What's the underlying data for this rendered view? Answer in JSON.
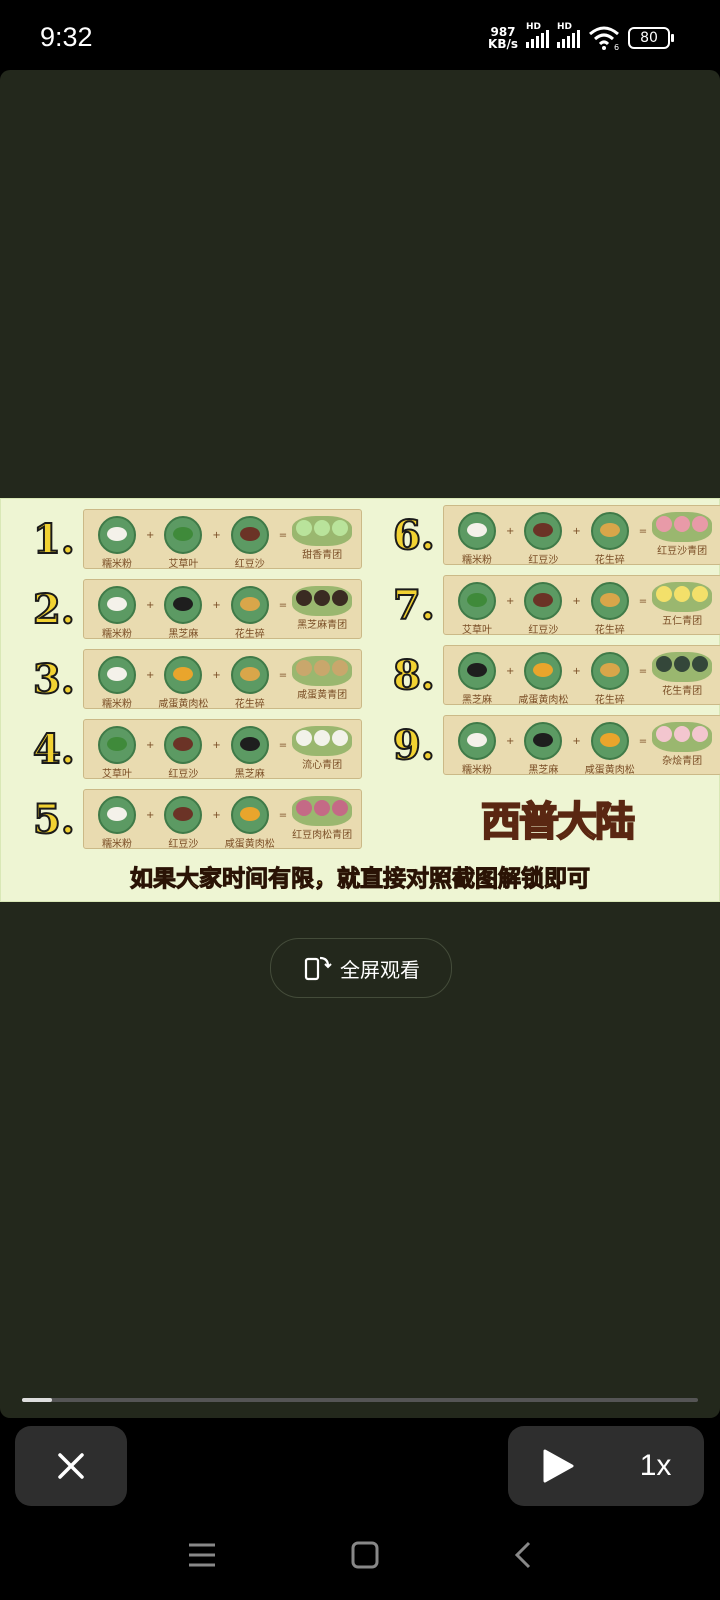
{
  "status": {
    "time": "9:32",
    "net_speed": "987",
    "net_unit": "KB/s",
    "hd": "HD",
    "battery": "80",
    "wifi_tag": "6"
  },
  "slide": {
    "left_recipes": [
      {
        "num": "1.",
        "ingredients": [
          "糯米粉",
          "艾草叶",
          "红豆沙"
        ],
        "result": "甜香青团"
      },
      {
        "num": "2.",
        "ingredients": [
          "糯米粉",
          "黑芝麻",
          "花生碎"
        ],
        "result": "黑芝麻青团"
      },
      {
        "num": "3.",
        "ingredients": [
          "糯米粉",
          "咸蛋黄肉松",
          "花生碎"
        ],
        "result": "咸蛋黄青团"
      },
      {
        "num": "4.",
        "ingredients": [
          "艾草叶",
          "红豆沙",
          "黑芝麻"
        ],
        "result": "流心青团"
      },
      {
        "num": "5.",
        "ingredients": [
          "糯米粉",
          "红豆沙",
          "咸蛋黄肉松"
        ],
        "result": "红豆肉松青团"
      }
    ],
    "right_recipes": [
      {
        "num": "6.",
        "ingredients": [
          "糯米粉",
          "红豆沙",
          "花生碎"
        ],
        "result": "红豆沙青团"
      },
      {
        "num": "7.",
        "ingredients": [
          "艾草叶",
          "红豆沙",
          "花生碎"
        ],
        "result": "五仁青团"
      },
      {
        "num": "8.",
        "ingredients": [
          "黑芝麻",
          "咸蛋黄肉松",
          "花生碎"
        ],
        "result": "花生青团"
      },
      {
        "num": "9.",
        "ingredients": [
          "糯米粉",
          "黑芝麻",
          "咸蛋黄肉松"
        ],
        "result": "杂烩青团"
      }
    ],
    "logo": "西普大陆",
    "caption": "如果大家时间有限，就直接对照截图解锁即可"
  },
  "controls": {
    "fullscreen_label": "全屏观看",
    "speed": "1x",
    "progress": 0.045
  },
  "colors": {
    "video_bg": "#23281c",
    "slide_bg": "#eef5d3",
    "number_yellow": "#f1d232"
  }
}
